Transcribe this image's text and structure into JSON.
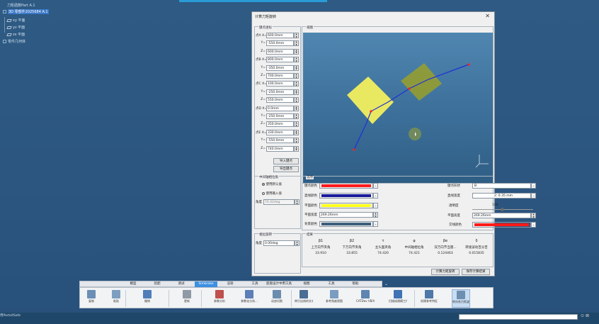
{
  "tree": {
    "root": "力矩函数Part A.1",
    "selected": "3D 零部件2025684 A.1",
    "planes": [
      "xy 平面",
      "yz 平面",
      "zx 平面"
    ],
    "body": "零件几何体"
  },
  "dialog": {
    "title": "计算力矩旋转",
    "close": "✕",
    "points_group": "键点坐标",
    "view_group": "视图",
    "points": [
      {
        "name": "点A X=",
        "label": "X=",
        "value": "600.0mm"
      },
      {
        "name": "",
        "label": "Y=",
        "value": "-550.0mm"
      },
      {
        "name": "",
        "label": "Z=",
        "value": "600.0mm"
      },
      {
        "name": "点B X=",
        "label": "X=",
        "value": "800.0mm"
      },
      {
        "name": "",
        "label": "Y=",
        "value": "-350.0mm"
      },
      {
        "name": "",
        "label": "Z=",
        "value": "700.0mm"
      },
      {
        "name": "点C X=",
        "label": "X=",
        "value": "100.0mm"
      },
      {
        "name": "",
        "label": "Y=",
        "value": "-250.0mm"
      },
      {
        "name": "",
        "label": "Z=",
        "value": "550.0mm"
      },
      {
        "name": "点D X=",
        "label": "X=",
        "value": "0.0mm"
      },
      {
        "name": "",
        "label": "Y=",
        "value": "-250.0mm"
      },
      {
        "name": "",
        "label": "Z=",
        "value": "350.0mm"
      },
      {
        "name": "点E X=",
        "label": "X=",
        "value": "330.0mm"
      },
      {
        "name": "",
        "label": "Y=",
        "value": "-550.0mm"
      },
      {
        "name": "",
        "label": "Z=",
        "value": "740.0mm"
      }
    ],
    "import_button": "导入键点",
    "export_button": "导出键点",
    "joint_group": "中间轴相位角",
    "radio_default": "使用默认值",
    "radio_input": "使用输入值",
    "angle_label": "角度",
    "angle_value": "74.42deg",
    "options_group": "选项",
    "key_color_label": "键点颜色",
    "line_color_label": "直线颜色",
    "plane_color_label": "平面颜色",
    "plane_width_label": "平面宽度",
    "plane_width_value": "269.26mm",
    "bg_color_label": "背景颜色",
    "key_shape_label": "键点形状",
    "key_shape_value": "B",
    "line_width_label": "直线宽度",
    "line_width_value": "2: 0.35 mm",
    "transparency_label": "透明度",
    "transparency_value": "104",
    "plane_height_label": "平面高度",
    "plane_height_value": "269.26mm",
    "intersect_color_label": "交线颜色",
    "colors": {
      "key": "#ff1a1a",
      "line": "#1a1a9c",
      "plane": "#ffff1a",
      "bg": "#3d5f7d",
      "intersect": "#ff1a1a"
    },
    "offset_group": "相位旋转",
    "offset_label": "角度",
    "offset_value": "0.00deg",
    "result_group": "结果",
    "result_headers": [
      "β1",
      "β2",
      "τ",
      "φ",
      "βe",
      "δ"
    ],
    "result_subheaders": [
      "上万向节夹角",
      "下万向节夹角",
      "主头面夹角",
      "中间轴相位角",
      "双万向节当量...",
      "转速波动百分百"
    ],
    "result_values": [
      "33.910",
      "33.855",
      "74.420",
      "74.421",
      "0.124463",
      "0.015835"
    ],
    "calc_button": "计算力矩旋转",
    "save_button": "保存计算结果"
  },
  "ribbon": {
    "tabs": [
      "模型",
      "装配",
      "测试",
      "Simbrake",
      "渲染",
      "工具",
      "底盘设计中用工具",
      "视图",
      "工具",
      "帮助"
    ],
    "active_tab": "Simbrake",
    "tools": [
      "复制",
      "粘贴",
      "撤销",
      "更新",
      "参数分析",
      "参数化分析...",
      "动态切割",
      "带引出线的文本",
      "参考角度视图",
      "CATDev VB/VI...",
      "扫描成建模工作对象...",
      "创建参考特征",
      "转向系力矩波动"
    ],
    "active_tool": "转向系力矩波动"
  },
  "statusbar": {
    "command": "用Parts/tSafe"
  }
}
